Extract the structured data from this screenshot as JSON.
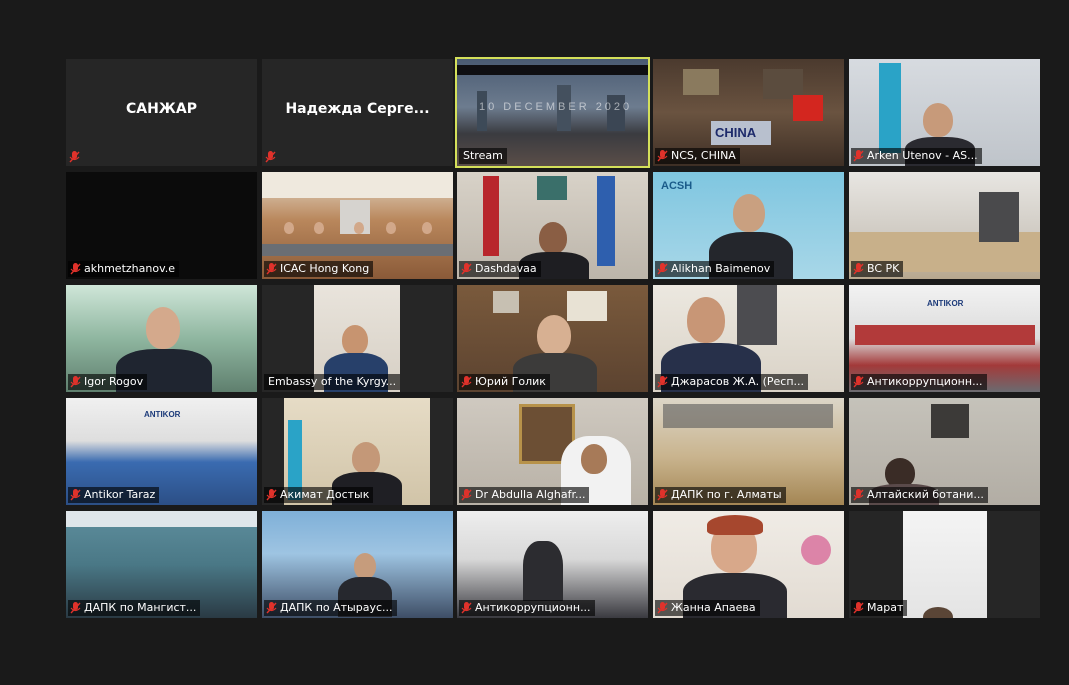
{
  "meeting": {
    "tiles": [
      {
        "name": "САНЖАР",
        "muted": true,
        "video": false,
        "active": false
      },
      {
        "name": "Надежда  Серге...",
        "muted": true,
        "video": false,
        "active": false
      },
      {
        "name": "Stream",
        "muted": false,
        "video": true,
        "active": true,
        "overlay_text": "10 DECEMBER 2020"
      },
      {
        "name": "NCS, CHINA",
        "muted": true,
        "video": true,
        "active": false,
        "overlay_text": "CHINA"
      },
      {
        "name": "Arken Utenov - AS...",
        "muted": true,
        "video": true,
        "active": false
      },
      {
        "name": "akhmetzhanov.e",
        "muted": true,
        "video": true,
        "active": false
      },
      {
        "name": "ICAC Hong Kong",
        "muted": true,
        "video": true,
        "active": false
      },
      {
        "name": "Dashdavaa",
        "muted": true,
        "video": true,
        "active": false
      },
      {
        "name": "Alikhan Baimenov",
        "muted": true,
        "video": true,
        "active": false,
        "overlay_text": "ACSH"
      },
      {
        "name": "BC PK",
        "muted": true,
        "video": true,
        "active": false
      },
      {
        "name": "Igor Rogov",
        "muted": true,
        "video": true,
        "active": false
      },
      {
        "name": "Embassy of the Kyrgy...",
        "muted": false,
        "video": true,
        "active": false
      },
      {
        "name": "Юрий Голик",
        "muted": true,
        "video": true,
        "active": false
      },
      {
        "name": "Джарасов Ж.А. (Респ...",
        "muted": true,
        "video": true,
        "active": false
      },
      {
        "name": "Антикоррупционн...",
        "muted": true,
        "video": true,
        "active": false,
        "overlay_text": "ANTIKOR"
      },
      {
        "name": "Antikor Taraz",
        "muted": true,
        "video": true,
        "active": false,
        "overlay_text": "ANTIKOR"
      },
      {
        "name": "Акимат Достык",
        "muted": true,
        "video": true,
        "active": false
      },
      {
        "name": "Dr Abdulla Alghafr...",
        "muted": true,
        "video": true,
        "active": false
      },
      {
        "name": "ДАПК по г. Алматы",
        "muted": true,
        "video": true,
        "active": false
      },
      {
        "name": "Алтайский ботани...",
        "muted": true,
        "video": true,
        "active": false
      },
      {
        "name": "ДАПК по Мангист...",
        "muted": true,
        "video": true,
        "active": false
      },
      {
        "name": "ДАПК по Атырауc...",
        "muted": true,
        "video": true,
        "active": false
      },
      {
        "name": "Антикоррупционн...",
        "muted": true,
        "video": true,
        "active": false
      },
      {
        "name": "Жанна Апаева",
        "muted": true,
        "video": true,
        "active": false
      },
      {
        "name": "Марат",
        "muted": true,
        "video": true,
        "active": false
      }
    ]
  },
  "colors": {
    "background": "#1a1a1a",
    "tile_empty": "#262626",
    "active_border": "#d4e05a",
    "muted_icon": "#e0322b"
  }
}
